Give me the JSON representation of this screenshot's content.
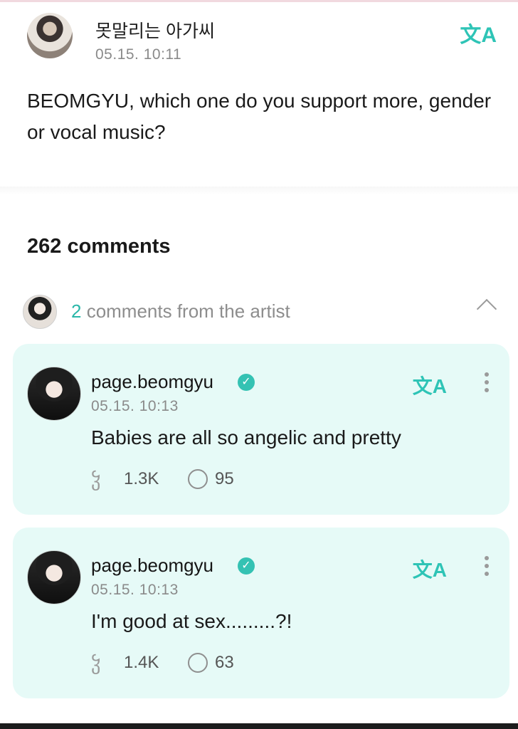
{
  "post": {
    "author": "못말리는 아가씨",
    "time": "05.15. 10:11",
    "body": "BEOMGYU, which one do you support more, gender or vocal music?",
    "translate_icon": "文A"
  },
  "comments_header": {
    "count_label": "262 comments",
    "artist_count": "2",
    "artist_label": " comments from the artist"
  },
  "comments": [
    {
      "author": "page.beomgyu",
      "verified": "✓",
      "time": "05.15. 10:13",
      "text": "Babies are all so angelic and pretty",
      "likes": "1.3K",
      "replies": "95",
      "translate_icon": "文A"
    },
    {
      "author": "page.beomgyu",
      "verified": "✓",
      "time": "05.15. 10:13",
      "text": "I'm good at sex.........?!",
      "likes": "1.4K",
      "replies": "63",
      "translate_icon": "文A"
    }
  ],
  "icons": {
    "like": "ჴ",
    "accent_color": "#2ec4b6",
    "card_bg": "#e6faf7"
  }
}
